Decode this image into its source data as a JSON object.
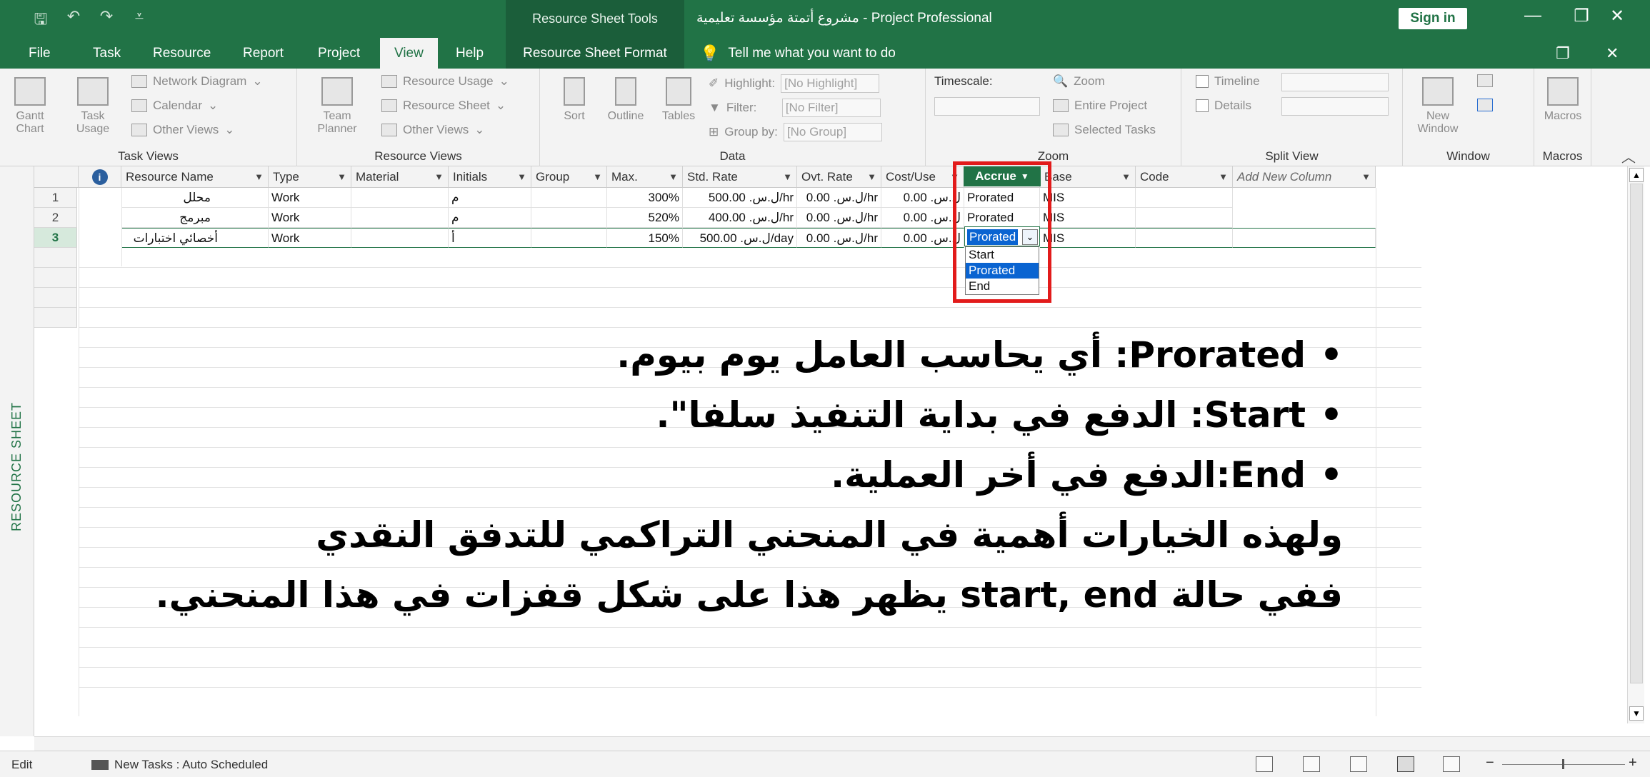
{
  "titlebar": {
    "context_tab": "Resource Sheet Tools",
    "doc_title": "مشروع أتمتة مؤسسة تعليمية  -  Project Professional",
    "sign_in": "Sign in",
    "minimize": "—",
    "restore": "❐",
    "close": "✕"
  },
  "tabs": {
    "file": "File",
    "task": "Task",
    "resource": "Resource",
    "report": "Report",
    "project": "Project",
    "view": "View",
    "help": "Help",
    "format": "Resource Sheet Format",
    "tell_me": "Tell me what you want to do",
    "restore2": "❐",
    "close2": "✕"
  },
  "ribbon": {
    "task_views": {
      "gantt": "Gantt Chart",
      "task_usage": "Task Usage",
      "network": "Network Diagram",
      "calendar": "Calendar",
      "other": "Other Views",
      "label": "Task Views"
    },
    "resource_views": {
      "team_planner": "Team Planner",
      "usage": "Resource Usage",
      "sheet": "Resource Sheet",
      "other": "Other Views",
      "label": "Resource Views"
    },
    "data": {
      "sort": "Sort",
      "outline": "Outline",
      "tables": "Tables",
      "highlight": "Highlight:",
      "highlight_val": "[No Highlight]",
      "filter": "Filter:",
      "filter_val": "[No Filter]",
      "group": "Group by:",
      "group_val": "[No Group]",
      "label": "Data"
    },
    "zoom": {
      "timescale": "Timescale:",
      "zoom": "Zoom",
      "entire": "Entire Project",
      "selected": "Selected Tasks",
      "label": "Zoom"
    },
    "split": {
      "timeline": "Timeline",
      "details": "Details",
      "label": "Split View"
    },
    "window": {
      "new_window": "New Window",
      "label": "Window"
    },
    "macros": {
      "macros": "Macros",
      "label": "Macros"
    }
  },
  "sheet": {
    "side_label": "RESOURCE SHEET",
    "headers": [
      "Resource Name",
      "Type",
      "Material",
      "Initials",
      "Group",
      "Max.",
      "Std. Rate",
      "Ovt. Rate",
      "Cost/Use",
      "Accrue",
      "Base",
      "Code",
      "Add New Column"
    ],
    "rows": [
      {
        "id": "1",
        "name": "محلل",
        "type": "Work",
        "initials": "م",
        "max": "300%",
        "std": "500.00 ل.س.‏/hr",
        "ovt": "0.00 ل.س.‏/hr",
        "cost": "0.00 ل.س.‏",
        "accrue": "Prorated",
        "base": "MIS"
      },
      {
        "id": "2",
        "name": "مبرمج",
        "type": "Work",
        "initials": "م",
        "max": "520%",
        "std": "400.00 ل.س.‏/hr",
        "ovt": "0.00 ل.س.‏/hr",
        "cost": "0.00 ل.س.‏",
        "accrue": "Prorated",
        "base": "MIS"
      },
      {
        "id": "3",
        "name": "أخصائي اختبارات",
        "type": "Work",
        "initials": "أ",
        "max": "150%",
        "std": "500.00 ل.س.‏/day",
        "ovt": "0.00 ل.س.‏/hr",
        "cost": "0.00 ل.س.‏",
        "accrue": "Prorated",
        "base": "MIS"
      }
    ],
    "dropdown_options": [
      "Start",
      "Prorated",
      "End"
    ]
  },
  "overlay": {
    "bullet": "•",
    "line1_term": "Prorated",
    "line1_text": ": أي يحاسب العامل يوم بيوم.",
    "line2_term": "Start",
    "line2_text": ": الدفع في بداية التنفيذ سلفا\".",
    "line3_term": "End",
    "line3_text": ":الدفع في أخر العملية.",
    "line4": "ولهذه الخيارات أهمية في المنحني التراكمي للتدفق النقدي",
    "line5": "ففي حالة start, end يظهر هذا على شكل قفزات في هذا المنحني."
  },
  "status": {
    "mode": "Edit",
    "new_tasks": "New Tasks : Auto Scheduled",
    "zoom_minus": "−",
    "zoom_plus": "+"
  },
  "colors": {
    "accent": "#217346",
    "highlight_red": "#e21b1b",
    "selection_blue": "#0a64d1"
  }
}
